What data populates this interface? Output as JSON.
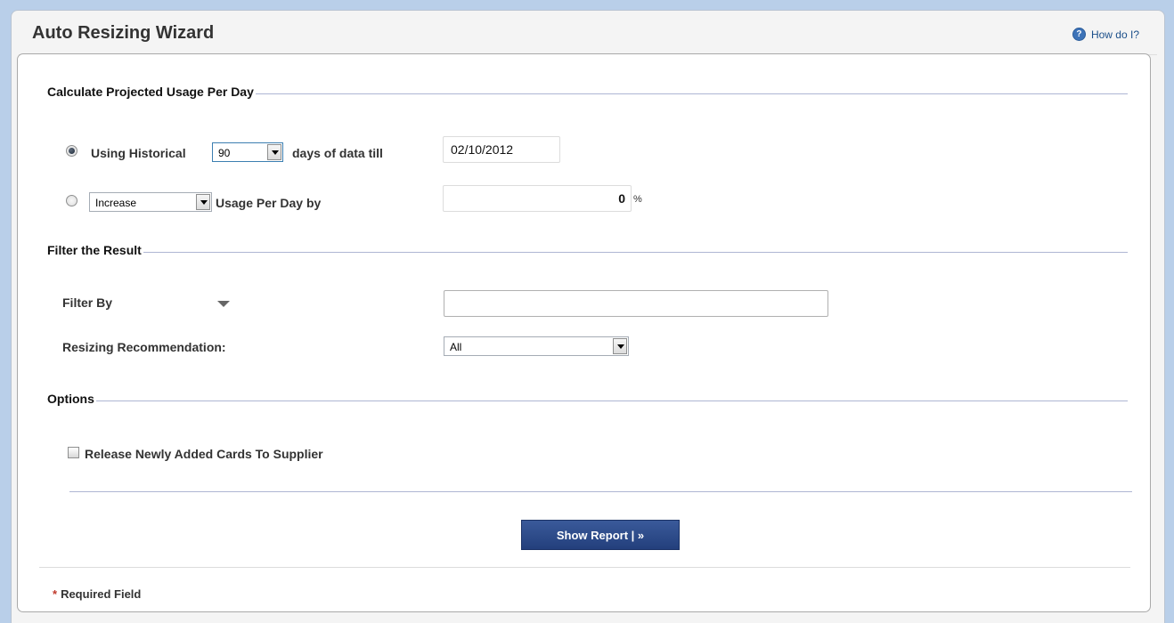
{
  "header": {
    "title": "Auto Resizing Wizard",
    "help_label": "How do I?",
    "help_icon": "question-circle-icon"
  },
  "section_usage": {
    "title": "Calculate Projected Usage Per Day",
    "historical_label": "Using Historical",
    "days_value": "90",
    "days_suffix": "days of data till",
    "till_date": "02/10/2012",
    "adjust_value": "Increase",
    "adjust_suffix": "Usage Per Day by",
    "percent_value": "0",
    "percent_symbol": "%",
    "selected_option": "historical"
  },
  "section_filter": {
    "title": "Filter the Result",
    "filter_by_value": "Filter By",
    "filter_text_value": "",
    "recommendation_label": "Resizing Recommendation:",
    "recommendation_value": "All"
  },
  "section_options": {
    "title": "Options",
    "release_label": "Release Newly Added Cards To Supplier",
    "release_checked": false
  },
  "actions": {
    "show_report_label": "Show Report | »"
  },
  "footer": {
    "required_star": "*",
    "required_label": "Required Field"
  },
  "colors": {
    "background": "#b9cfe9",
    "button": "#2b4886",
    "required_star": "#c0392b",
    "section_line": "#aeb6d3"
  }
}
